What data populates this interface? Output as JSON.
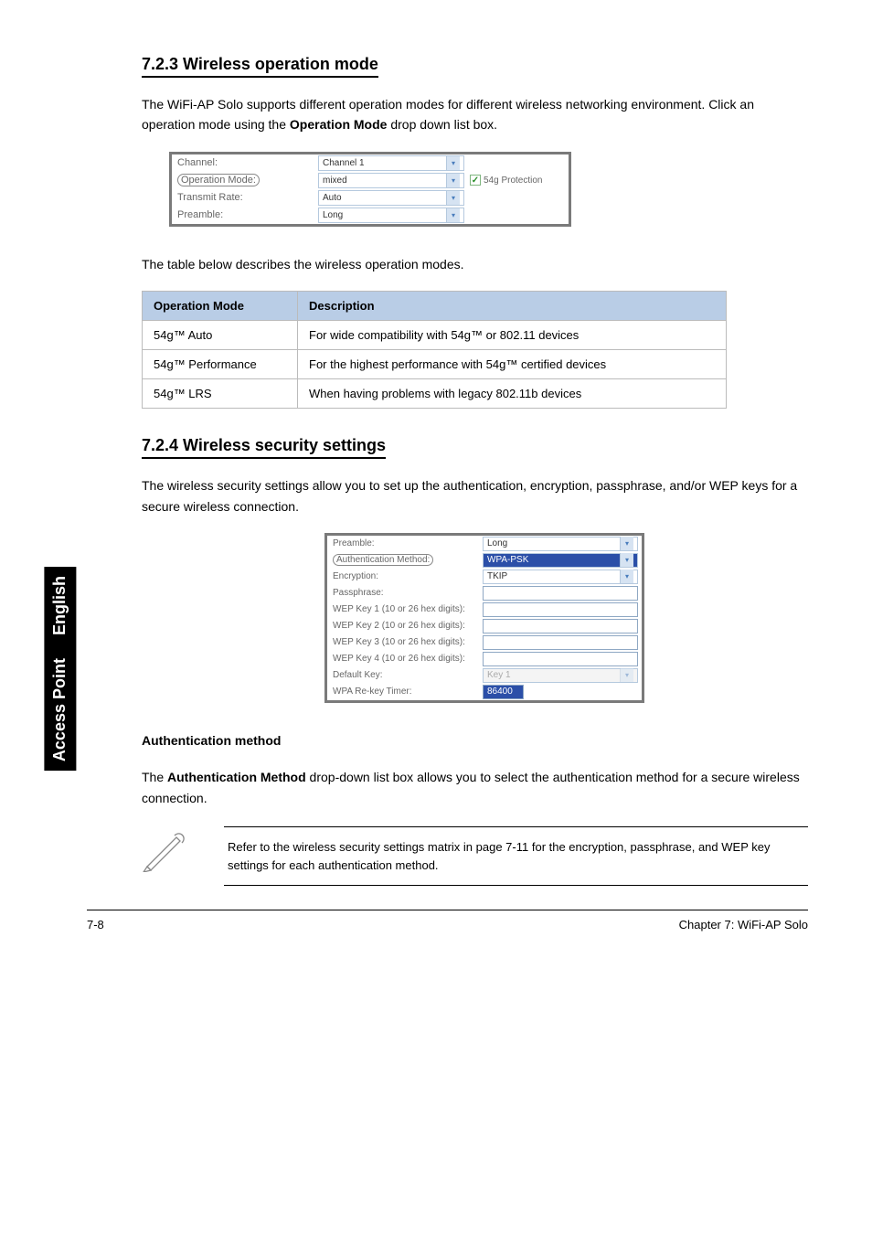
{
  "page_num_top": "7-8",
  "side_tab_line1": "English",
  "side_tab_line2": "Access Point",
  "sec1": {
    "heading": "7.2.3 Wireless operation mode",
    "para": "The WiFi-AP Solo supports different operation modes for different wireless networking environment. Click an operation mode using the Operation Mode drop down list box.",
    "para_bold": "Operation Mode",
    "fig": {
      "channel_label": "Channel:",
      "channel_value": "Channel 1",
      "opmode_label": "Operation Mode:",
      "opmode_value": "mixed",
      "protection_label": "54g Protection",
      "tx_label": "Transmit Rate:",
      "tx_value": "Auto",
      "preamble_label": "Preamble:",
      "preamble_value": "Long"
    },
    "table_title": "The table below describes the wireless operation modes.",
    "table": {
      "h1": "Operation Mode",
      "h2": "Description",
      "rows": [
        {
          "mode": "54g™ Auto",
          "desc": "For wide compatibility with 54g™ or 802.11 devices"
        },
        {
          "mode": "54g™ Performance",
          "desc": "For the highest performance with 54g™ certified devices"
        },
        {
          "mode": "54g™ LRS",
          "desc": "When having problems with legacy 802.11b devices"
        }
      ]
    }
  },
  "sec2": {
    "heading": "7.2.4 Wireless security settings",
    "para": "The wireless security settings allow you to set up the authentication, encryption, passphrase, and/or WEP keys for a secure wireless connection.",
    "fig": {
      "preamble_l": "Preamble:",
      "preamble_v": "Long",
      "auth_l": "Authentication Method:",
      "auth_v": "WPA-PSK",
      "enc_l": "Encryption:",
      "enc_v": "TKIP",
      "pass_l": "Passphrase:",
      "wep1_l": "WEP Key 1 (10 or 26 hex digits):",
      "wep2_l": "WEP Key 2 (10 or 26 hex digits):",
      "wep3_l": "WEP Key 3 (10 or 26 hex digits):",
      "wep4_l": "WEP Key 4 (10 or 26 hex digits):",
      "defk_l": "Default Key:",
      "defk_v": "Key 1",
      "rekey_l": "WPA Re-key Timer:",
      "rekey_v": "86400"
    },
    "auth_heading": "Authentication method",
    "auth_para": "The Authentication Method drop-down list box allows you to select the authentication method for a secure wireless connection.",
    "auth_bold": "Authentication Method"
  },
  "note_text": "Refer to the wireless security settings matrix in page 7-11 for the encryption, passphrase, and WEP key settings for each authentication method.",
  "footer_left": "7-8",
  "footer_right": "Chapter 7: WiFi-AP Solo"
}
